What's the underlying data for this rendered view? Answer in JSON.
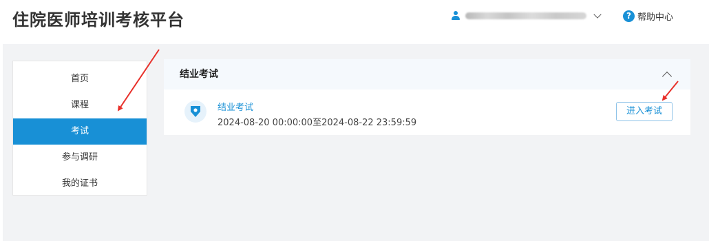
{
  "app": {
    "title": "住院医师培训考核平台"
  },
  "header": {
    "help_label": "帮助中心"
  },
  "sidebar": {
    "items": [
      {
        "label": "首页",
        "active": false
      },
      {
        "label": "课程",
        "active": false
      },
      {
        "label": "考试",
        "active": true
      },
      {
        "label": "参与调研",
        "active": false
      },
      {
        "label": "我的证书",
        "active": false
      }
    ]
  },
  "panel": {
    "title": "结业考试",
    "exam": {
      "name": "结业考试",
      "time_range": "2024-08-20 00:00:00至2024-08-22 23:59:59",
      "enter_label": "进入考试"
    }
  },
  "colors": {
    "accent": "#1890d6",
    "annotation": "#e8302a",
    "background": "#f2f3f5"
  },
  "icons": {
    "user": "user-icon",
    "help": "help-icon",
    "dropdown": "chevron-down-icon",
    "collapse": "chevron-up-icon",
    "exam": "exam-badge-icon"
  }
}
